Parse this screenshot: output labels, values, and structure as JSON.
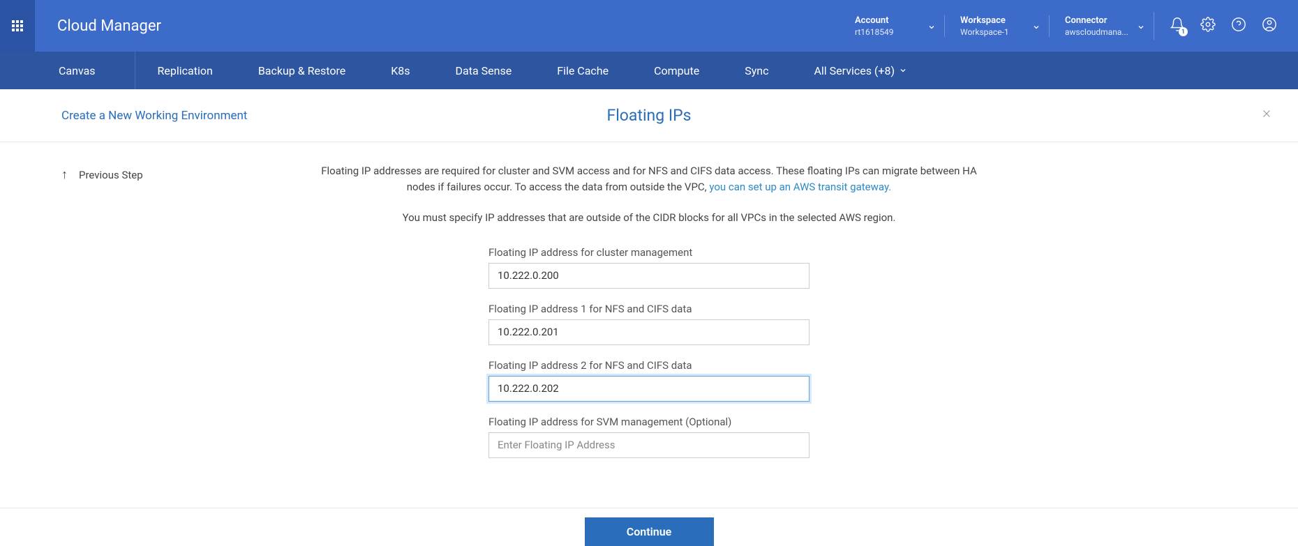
{
  "header": {
    "brand": "Cloud Manager",
    "account": {
      "label": "Account",
      "value": "rt1618549"
    },
    "workspace": {
      "label": "Workspace",
      "value": "Workspace-1"
    },
    "connector": {
      "label": "Connector",
      "value": "awscloudmana..."
    },
    "bell_badge": "1"
  },
  "nav": {
    "items": [
      "Canvas",
      "Replication",
      "Backup & Restore",
      "K8s",
      "Data Sense",
      "File Cache",
      "Compute",
      "Sync"
    ],
    "all_services": "All Services (+8)"
  },
  "subhead": {
    "breadcrumb": "Create a New Working Environment",
    "title": "Floating IPs"
  },
  "main": {
    "prev_step": "Previous Step",
    "desc_part1": "Floating IP addresses are required for cluster and SVM access and for NFS and CIFS data access. These floating IPs can migrate between HA nodes if failures occur. To access the data from outside the VPC, ",
    "desc_link": "you can set up an AWS transit gateway.",
    "desc2": "You must specify IP addresses that are outside of the CIDR blocks for all VPCs in the selected AWS region.",
    "fields": {
      "cluster_mgmt": {
        "label": "Floating IP address for cluster management",
        "value": "10.222.0.200"
      },
      "nfs1": {
        "label": "Floating IP address 1 for NFS and CIFS data",
        "value": "10.222.0.201"
      },
      "nfs2": {
        "label": "Floating IP address 2 for NFS and CIFS data",
        "value": "10.222.0.202"
      },
      "svm": {
        "label": "Floating IP address for SVM management (Optional)",
        "value": "",
        "placeholder": "Enter Floating IP Address"
      }
    }
  },
  "footer": {
    "continue": "Continue"
  }
}
